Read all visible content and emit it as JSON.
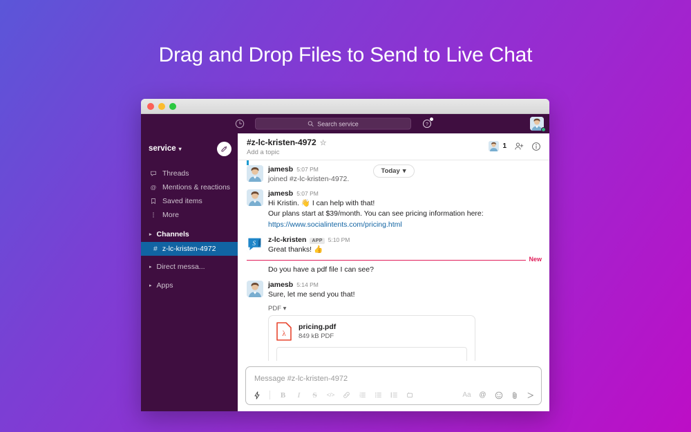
{
  "hero": {
    "title": "Drag and Drop Files to Send to Live Chat"
  },
  "window": {
    "traffic_lights": [
      "close",
      "minimize",
      "zoom"
    ],
    "colors": {
      "sidebar": "#3f0e40",
      "topbar": "#3f0e40",
      "active_channel": "#1164a3",
      "link": "#1264a3",
      "new_divider": "#e01e5a",
      "presence": "#2eb67d"
    }
  },
  "topbar": {
    "history_icon": "clock-icon",
    "search": {
      "icon": "search-icon",
      "placeholder": "Search service"
    },
    "help_icon": "help-circle-icon",
    "help_badge": true,
    "avatar": "user-avatar",
    "presence": "online"
  },
  "sidebar": {
    "workspace": {
      "name": "service",
      "chevron": "chevron-down-icon"
    },
    "compose_button": "compose-icon",
    "nav": [
      {
        "icon": "threads-icon",
        "label": "Threads"
      },
      {
        "icon": "at-icon",
        "label": "Mentions & reactions"
      },
      {
        "icon": "bookmark-icon",
        "label": "Saved items"
      },
      {
        "icon": "more-icon",
        "label": "More"
      }
    ],
    "sections": [
      {
        "label": "Channels",
        "expanded": true,
        "channels": [
          {
            "prefix": "#",
            "name": "z-lc-kristen-4972",
            "active": true
          }
        ]
      },
      {
        "label": "Direct messa...",
        "expanded": false,
        "channels": []
      },
      {
        "label": "Apps",
        "expanded": false,
        "channels": []
      }
    ]
  },
  "channel": {
    "title": "#z-lc-kristen-4972",
    "star_icon": "star-icon",
    "topic_placeholder": "Add a topic",
    "member_count": "1",
    "add_member_icon": "add-person-icon",
    "info_icon": "info-icon"
  },
  "messages": {
    "date_pill": {
      "label": "Today",
      "chevron": "chevron-down-icon"
    },
    "new_divider_label": "New",
    "items": [
      {
        "type": "message",
        "user": "jamesb",
        "time": "5:07 PM",
        "avatar": "user-avatar",
        "text": "joined #z-lc-kristen-4972.",
        "muted": true
      },
      {
        "type": "message",
        "user": "jamesb",
        "time": "5:07 PM",
        "avatar": "user-avatar",
        "text": "Hi Kristin.  👋 I can help with that!"
      },
      {
        "type": "continuation",
        "text": "Our plans start at $39/month.  You can see pricing information here:"
      },
      {
        "type": "link",
        "text": "https://www.socialintents.com/pricing.html"
      },
      {
        "type": "message",
        "user": "z-lc-kristen",
        "badge": "APP",
        "time": "5:10 PM",
        "avatar": "app-avatar",
        "text": "Great thanks! 👍"
      },
      {
        "type": "continuation",
        "text": "Do you have a pdf file I can see?"
      },
      {
        "type": "message",
        "user": "jamesb",
        "time": "5:14 PM",
        "avatar": "user-avatar",
        "text": "Sure, let me send you that!"
      }
    ],
    "attachment": {
      "type_label": "PDF",
      "type_chevron": "chevron-down-icon",
      "file_icon": "pdf-file-icon",
      "filename": "pricing.pdf",
      "filemeta": "849 kB PDF"
    }
  },
  "composer": {
    "placeholder": "Message #z-lc-kristen-4972",
    "tools_left": [
      {
        "icon": "lightning-icon",
        "label": ""
      },
      {
        "icon": "bold-icon",
        "label": "B"
      },
      {
        "icon": "italic-icon",
        "label": "I"
      },
      {
        "icon": "strikethrough-icon",
        "label": "S"
      },
      {
        "icon": "code-icon",
        "label": "</>"
      },
      {
        "icon": "link-icon",
        "label": ""
      },
      {
        "icon": "ordered-list-icon",
        "label": ""
      },
      {
        "icon": "bulleted-list-icon",
        "label": ""
      },
      {
        "icon": "blockquote-icon",
        "label": ""
      },
      {
        "icon": "code-block-icon",
        "label": ""
      }
    ],
    "tools_right": [
      {
        "icon": "formatting-icon",
        "label": "Aa"
      },
      {
        "icon": "mention-icon",
        "label": "@"
      },
      {
        "icon": "emoji-icon",
        "label": ""
      },
      {
        "icon": "attach-icon",
        "label": ""
      },
      {
        "icon": "send-icon",
        "label": ""
      }
    ]
  }
}
